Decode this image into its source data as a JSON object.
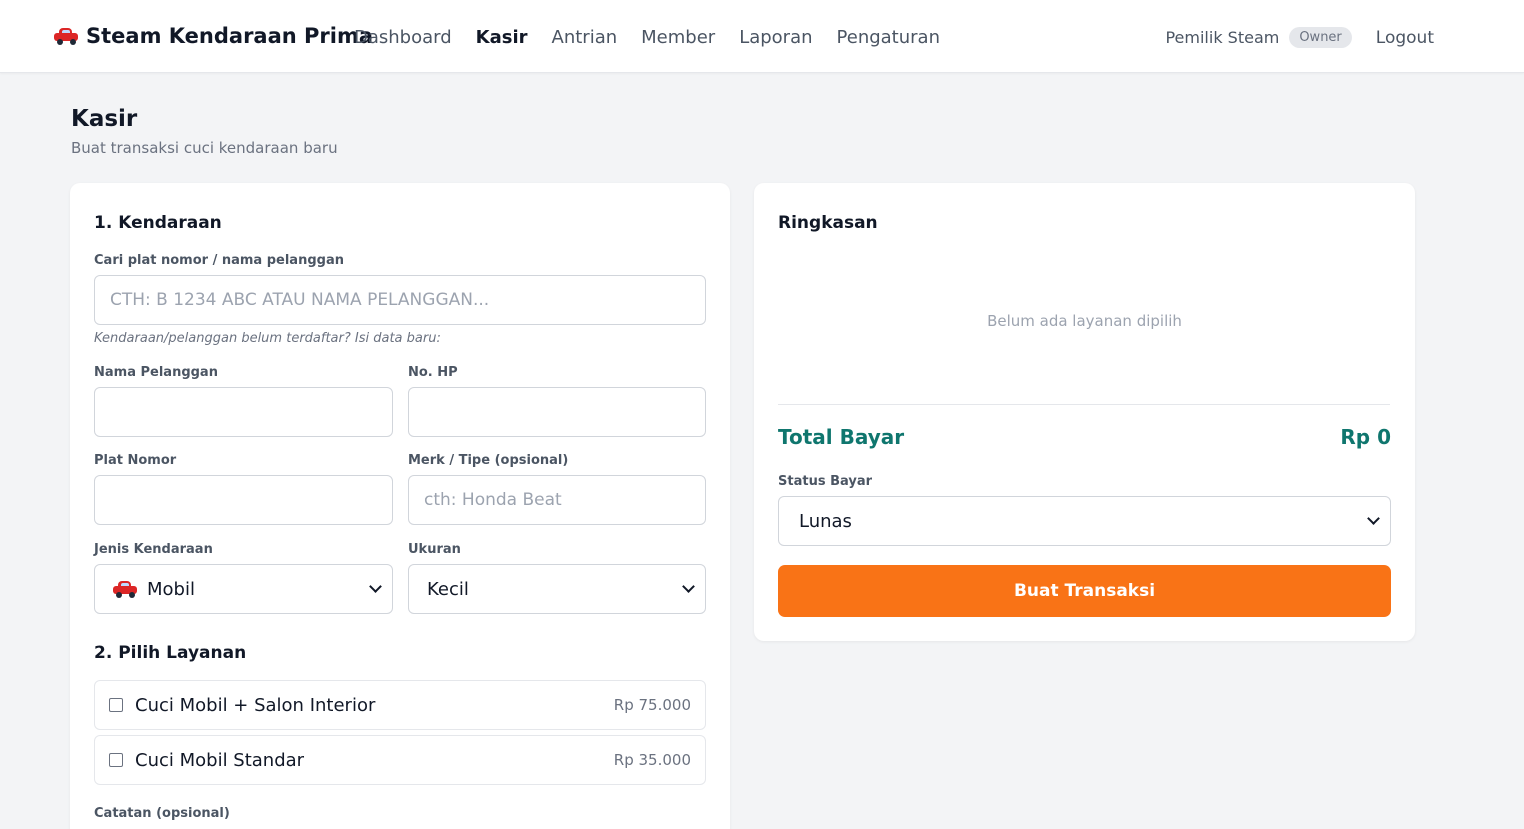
{
  "header": {
    "brand": "Steam Kendaraan Prima",
    "nav": [
      "Dashboard",
      "Kasir",
      "Antrian",
      "Member",
      "Laporan",
      "Pengaturan"
    ],
    "active_nav": "Kasir",
    "user_name": "Pemilik Steam",
    "role_badge": "Owner",
    "logout": "Logout"
  },
  "page": {
    "title": "Kasir",
    "subtitle": "Buat transaksi cuci kendaraan baru"
  },
  "vehicle_section": {
    "title": "1. Kendaraan",
    "search_label": "Cari plat nomor / nama pelanggan",
    "search_placeholder": "CTH: B 1234 ABC ATAU NAMA PELANGGAN...",
    "hint": "Kendaraan/pelanggan belum terdaftar? Isi data baru:",
    "name_label": "Nama Pelanggan",
    "name_value": "",
    "phone_label": "No. HP",
    "phone_value": "",
    "plate_label": "Plat Nomor",
    "plate_value": "",
    "brand_label": "Merk / Tipe (opsional)",
    "brand_placeholder": "cth: Honda Beat",
    "type_label": "Jenis Kendaraan",
    "type_value": "Mobil",
    "size_label": "Ukuran",
    "size_value": "Kecil"
  },
  "services_section": {
    "title": "2. Pilih Layanan",
    "services": [
      {
        "name": "Cuci Mobil + Salon Interior",
        "price": "Rp 75.000",
        "checked": false
      },
      {
        "name": "Cuci Mobil Standar",
        "price": "Rp 35.000",
        "checked": false
      }
    ],
    "notes_label": "Catatan (opsional)"
  },
  "summary": {
    "title": "Ringkasan",
    "empty_text": "Belum ada layanan dipilih",
    "total_label": "Total Bayar",
    "total_value": "Rp 0",
    "status_label": "Status Bayar",
    "status_value": "Lunas",
    "submit": "Buat Transaksi"
  },
  "colors": {
    "accent": "#f97316",
    "total": "#0f766e",
    "car": "#dc2626"
  }
}
